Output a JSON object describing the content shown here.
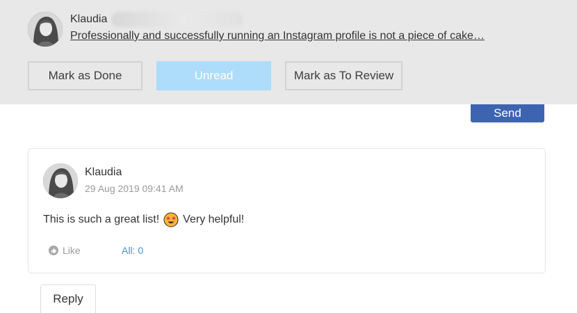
{
  "notification": {
    "author": "Klaudia",
    "post_title": "Professionally and successfully running an Instagram profile is not a piece of cake…",
    "buttons": {
      "mark_done": "Mark as Done",
      "unread": "Unread",
      "mark_review": "Mark as To Review"
    }
  },
  "send_label": "Send",
  "comment": {
    "author": "Klaudia",
    "timestamp": "29 Aug 2019 09:41 AM",
    "text_before": "This is such a great list!",
    "emoji": "star-struck-emoji",
    "text_after": "Very helpful!",
    "like_label": "Like",
    "count_label": "All: 0"
  },
  "reply_label": "Reply",
  "colors": {
    "topbar_bg": "#e8e8e8",
    "unread_button": "#aedcfb",
    "send_button": "#3e64b1",
    "link_blue": "#4a8fc9"
  }
}
